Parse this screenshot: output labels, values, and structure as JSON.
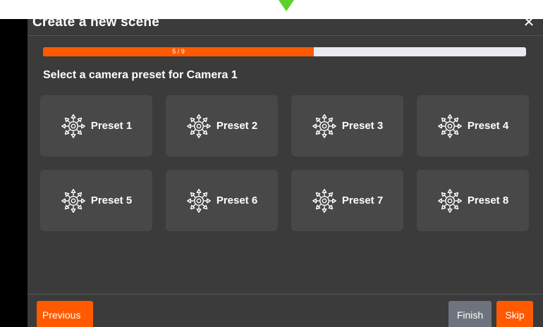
{
  "dialog": {
    "title": "Create a new scene",
    "close_label": "✕"
  },
  "progress": {
    "text": "5 / 9",
    "current": 5,
    "total": 9,
    "fill_fraction": 0.56
  },
  "prompt": "Select a camera preset for Camera 1",
  "presets": [
    {
      "label": "Preset 1"
    },
    {
      "label": "Preset 2"
    },
    {
      "label": "Preset 3"
    },
    {
      "label": "Preset 4"
    },
    {
      "label": "Preset 5"
    },
    {
      "label": "Preset 6"
    },
    {
      "label": "Preset 7"
    },
    {
      "label": "Preset 8"
    }
  ],
  "footer": {
    "previous_label": "Previous",
    "finish_label": "Finish",
    "skip_label": "Skip"
  },
  "colors": {
    "accent": "#ff5a00",
    "dialog_bg": "#3b3b3b",
    "tile_bg": "#484848",
    "finish_bg": "#6d747d",
    "pointer": "#5cd22a"
  },
  "icons": {
    "preset": "camera-preset-icon",
    "close": "close-icon",
    "pointer": "arrow-down-icon"
  }
}
